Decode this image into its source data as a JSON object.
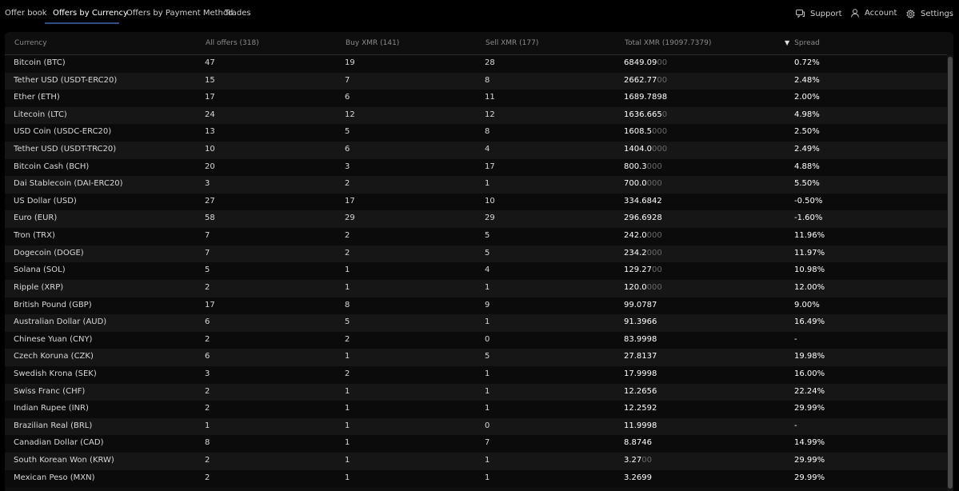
{
  "nav": {
    "tabs": [
      {
        "label": "Offer book"
      },
      {
        "label": "Offers by Currency"
      },
      {
        "label": "Offers by Payment Method"
      },
      {
        "label": "Trades"
      }
    ],
    "support": "Support",
    "account": "Account",
    "settings": "Settings"
  },
  "table": {
    "headers": {
      "currency": "Currency",
      "all_offers": "All offers (318)",
      "buy": "Buy XMR (141)",
      "sell": "Sell XMR (177)",
      "total": "Total XMR (19097.7379)",
      "spread": "Spread"
    },
    "sort_indicator": "▼",
    "rows": [
      {
        "currency": "Bitcoin (BTC)",
        "all": "47",
        "buy": "19",
        "sell": "28",
        "total_main": "6849.09",
        "total_pad": "00",
        "spread": "0.72%"
      },
      {
        "currency": "Tether USD (USDT-ERC20)",
        "all": "15",
        "buy": "7",
        "sell": "8",
        "total_main": "2662.77",
        "total_pad": "00",
        "spread": "2.48%"
      },
      {
        "currency": "Ether (ETH)",
        "all": "17",
        "buy": "6",
        "sell": "11",
        "total_main": "1689.7898",
        "total_pad": "",
        "spread": "2.00%"
      },
      {
        "currency": "Litecoin (LTC)",
        "all": "24",
        "buy": "12",
        "sell": "12",
        "total_main": "1636.665",
        "total_pad": "0",
        "spread": "4.98%"
      },
      {
        "currency": "USD Coin (USDC-ERC20)",
        "all": "13",
        "buy": "5",
        "sell": "8",
        "total_main": "1608.5",
        "total_pad": "000",
        "spread": "2.50%"
      },
      {
        "currency": "Tether USD (USDT-TRC20)",
        "all": "10",
        "buy": "6",
        "sell": "4",
        "total_main": "1404.0",
        "total_pad": "000",
        "spread": "2.49%"
      },
      {
        "currency": "Bitcoin Cash (BCH)",
        "all": "20",
        "buy": "3",
        "sell": "17",
        "total_main": "800.3",
        "total_pad": "000",
        "spread": "4.88%"
      },
      {
        "currency": "Dai Stablecoin (DAI-ERC20)",
        "all": "3",
        "buy": "2",
        "sell": "1",
        "total_main": "700.0",
        "total_pad": "000",
        "spread": "5.50%"
      },
      {
        "currency": "US Dollar (USD)",
        "all": "27",
        "buy": "17",
        "sell": "10",
        "total_main": "334.6842",
        "total_pad": "",
        "spread": "-0.50%"
      },
      {
        "currency": "Euro (EUR)",
        "all": "58",
        "buy": "29",
        "sell": "29",
        "total_main": "296.6928",
        "total_pad": "",
        "spread": "-1.60%"
      },
      {
        "currency": "Tron (TRX)",
        "all": "7",
        "buy": "2",
        "sell": "5",
        "total_main": "242.0",
        "total_pad": "000",
        "spread": "11.96%"
      },
      {
        "currency": "Dogecoin (DOGE)",
        "all": "7",
        "buy": "2",
        "sell": "5",
        "total_main": "234.2",
        "total_pad": "000",
        "spread": "11.97%"
      },
      {
        "currency": "Solana (SOL)",
        "all": "5",
        "buy": "1",
        "sell": "4",
        "total_main": "129.27",
        "total_pad": "00",
        "spread": "10.98%"
      },
      {
        "currency": "Ripple (XRP)",
        "all": "2",
        "buy": "1",
        "sell": "1",
        "total_main": "120.0",
        "total_pad": "000",
        "spread": "12.00%"
      },
      {
        "currency": "British Pound (GBP)",
        "all": "17",
        "buy": "8",
        "sell": "9",
        "total_main": "99.0787",
        "total_pad": "",
        "spread": "9.00%"
      },
      {
        "currency": "Australian Dollar (AUD)",
        "all": "6",
        "buy": "5",
        "sell": "1",
        "total_main": "91.3966",
        "total_pad": "",
        "spread": "16.49%"
      },
      {
        "currency": "Chinese Yuan (CNY)",
        "all": "2",
        "buy": "2",
        "sell": "0",
        "total_main": "83.9998",
        "total_pad": "",
        "spread": "-"
      },
      {
        "currency": "Czech Koruna (CZK)",
        "all": "6",
        "buy": "1",
        "sell": "5",
        "total_main": "27.8137",
        "total_pad": "",
        "spread": "19.98%"
      },
      {
        "currency": "Swedish Krona (SEK)",
        "all": "3",
        "buy": "2",
        "sell": "1",
        "total_main": "17.9998",
        "total_pad": "",
        "spread": "16.00%"
      },
      {
        "currency": "Swiss Franc (CHF)",
        "all": "2",
        "buy": "1",
        "sell": "1",
        "total_main": "12.2656",
        "total_pad": "",
        "spread": "22.24%"
      },
      {
        "currency": "Indian Rupee (INR)",
        "all": "2",
        "buy": "1",
        "sell": "1",
        "total_main": "12.2592",
        "total_pad": "",
        "spread": "29.99%"
      },
      {
        "currency": "Brazilian Real (BRL)",
        "all": "1",
        "buy": "1",
        "sell": "0",
        "total_main": "11.9998",
        "total_pad": "",
        "spread": "-"
      },
      {
        "currency": "Canadian Dollar (CAD)",
        "all": "8",
        "buy": "1",
        "sell": "7",
        "total_main": "8.8746",
        "total_pad": "",
        "spread": "14.99%"
      },
      {
        "currency": "South Korean Won (KRW)",
        "all": "2",
        "buy": "1",
        "sell": "1",
        "total_main": "3.27",
        "total_pad": "00",
        "spread": "29.99%"
      },
      {
        "currency": "Mexican Peso (MXN)",
        "all": "2",
        "buy": "1",
        "sell": "1",
        "total_main": "3.2699",
        "total_pad": "",
        "spread": "29.99%"
      }
    ]
  },
  "colors": {
    "background": "#000000",
    "panel": "#0e0e0e",
    "accent": "#2f4f82",
    "text": "#d8d8d8",
    "muted": "#8a8a8a"
  },
  "icons": {
    "support": "chat-icon",
    "account": "user-icon",
    "settings": "gear-icon"
  }
}
